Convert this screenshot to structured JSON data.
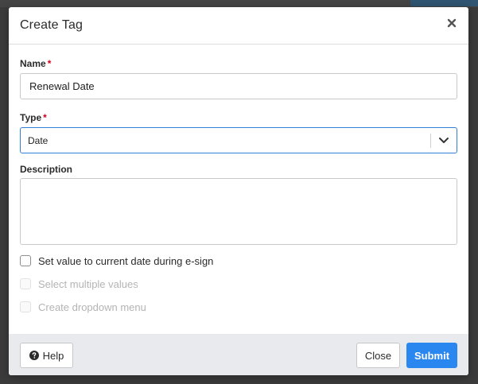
{
  "dialog": {
    "title": "Create Tag"
  },
  "form": {
    "name": {
      "label": "Name",
      "required_mark": "*",
      "value": "Renewal Date"
    },
    "type": {
      "label": "Type",
      "required_mark": "*",
      "selected": "Date"
    },
    "description": {
      "label": "Description",
      "value": ""
    },
    "options": [
      {
        "label": "Set value to current date during e-sign",
        "checked": false,
        "disabled": false
      },
      {
        "label": "Select multiple values",
        "checked": false,
        "disabled": true
      },
      {
        "label": "Create dropdown menu",
        "checked": false,
        "disabled": true
      }
    ]
  },
  "footer": {
    "help_label": "Help",
    "close_label": "Close",
    "submit_label": "Submit"
  },
  "colors": {
    "primary": "#2b87f0",
    "focus_border": "#2f7fd6",
    "required": "#d0021b",
    "footer_bg": "#e8eaed"
  },
  "icons": {
    "close": "close-icon",
    "select": "chevron-down-icon",
    "help": "question-circle-icon"
  }
}
